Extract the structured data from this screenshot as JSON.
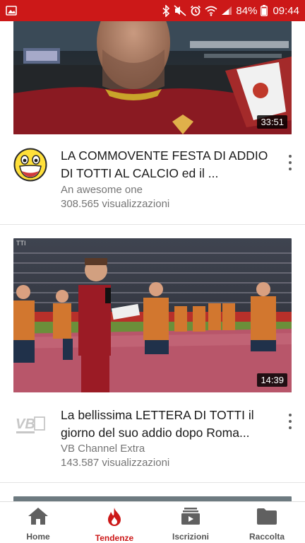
{
  "status_bar": {
    "battery_percent": "84%",
    "time": "09:44",
    "icons": [
      "image-notification-icon",
      "bluetooth-icon",
      "mute-icon",
      "alarm-icon",
      "wifi-icon",
      "signal-icon",
      "battery-icon"
    ]
  },
  "videos": [
    {
      "title": "LA COMMOVENTE FESTA DI ADDIO DI TOTTI AL CALCIO ed il ...",
      "channel": "An awesome one",
      "views": "308.565 visualizzazioni",
      "duration": "33:51"
    },
    {
      "title": "La bellissima LETTERA DI TOTTI il giorno del suo addio dopo Roma...",
      "channel": "VB Channel Extra",
      "views": "143.587 visualizzazioni",
      "duration": "14:39",
      "avatar_text": "VB"
    }
  ],
  "bottom_nav": {
    "items": [
      {
        "label": "Home",
        "icon": "home-icon"
      },
      {
        "label": "Tendenze",
        "icon": "flame-icon"
      },
      {
        "label": "Iscrizioni",
        "icon": "subscriptions-icon"
      },
      {
        "label": "Raccolta",
        "icon": "folder-icon"
      }
    ],
    "active": "Tendenze"
  },
  "colors": {
    "accent": "#cc1818",
    "text": "#1a1a1a",
    "secondary": "#757575"
  }
}
